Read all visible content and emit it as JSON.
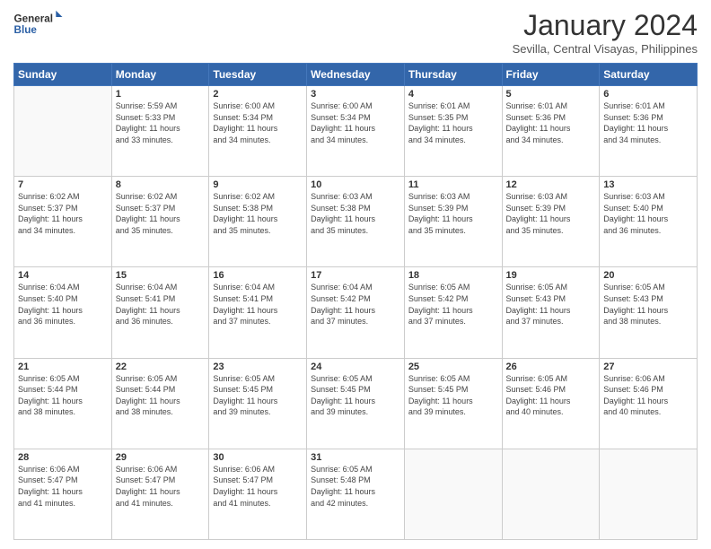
{
  "header": {
    "logo_line1": "General",
    "logo_line2": "Blue",
    "month_title": "January 2024",
    "location": "Sevilla, Central Visayas, Philippines"
  },
  "weekdays": [
    "Sunday",
    "Monday",
    "Tuesday",
    "Wednesday",
    "Thursday",
    "Friday",
    "Saturday"
  ],
  "weeks": [
    [
      {
        "day": "",
        "info": ""
      },
      {
        "day": "1",
        "info": "Sunrise: 5:59 AM\nSunset: 5:33 PM\nDaylight: 11 hours\nand 33 minutes."
      },
      {
        "day": "2",
        "info": "Sunrise: 6:00 AM\nSunset: 5:34 PM\nDaylight: 11 hours\nand 34 minutes."
      },
      {
        "day": "3",
        "info": "Sunrise: 6:00 AM\nSunset: 5:34 PM\nDaylight: 11 hours\nand 34 minutes."
      },
      {
        "day": "4",
        "info": "Sunrise: 6:01 AM\nSunset: 5:35 PM\nDaylight: 11 hours\nand 34 minutes."
      },
      {
        "day": "5",
        "info": "Sunrise: 6:01 AM\nSunset: 5:36 PM\nDaylight: 11 hours\nand 34 minutes."
      },
      {
        "day": "6",
        "info": "Sunrise: 6:01 AM\nSunset: 5:36 PM\nDaylight: 11 hours\nand 34 minutes."
      }
    ],
    [
      {
        "day": "7",
        "info": "Sunrise: 6:02 AM\nSunset: 5:37 PM\nDaylight: 11 hours\nand 34 minutes."
      },
      {
        "day": "8",
        "info": "Sunrise: 6:02 AM\nSunset: 5:37 PM\nDaylight: 11 hours\nand 35 minutes."
      },
      {
        "day": "9",
        "info": "Sunrise: 6:02 AM\nSunset: 5:38 PM\nDaylight: 11 hours\nand 35 minutes."
      },
      {
        "day": "10",
        "info": "Sunrise: 6:03 AM\nSunset: 5:38 PM\nDaylight: 11 hours\nand 35 minutes."
      },
      {
        "day": "11",
        "info": "Sunrise: 6:03 AM\nSunset: 5:39 PM\nDaylight: 11 hours\nand 35 minutes."
      },
      {
        "day": "12",
        "info": "Sunrise: 6:03 AM\nSunset: 5:39 PM\nDaylight: 11 hours\nand 35 minutes."
      },
      {
        "day": "13",
        "info": "Sunrise: 6:03 AM\nSunset: 5:40 PM\nDaylight: 11 hours\nand 36 minutes."
      }
    ],
    [
      {
        "day": "14",
        "info": "Sunrise: 6:04 AM\nSunset: 5:40 PM\nDaylight: 11 hours\nand 36 minutes."
      },
      {
        "day": "15",
        "info": "Sunrise: 6:04 AM\nSunset: 5:41 PM\nDaylight: 11 hours\nand 36 minutes."
      },
      {
        "day": "16",
        "info": "Sunrise: 6:04 AM\nSunset: 5:41 PM\nDaylight: 11 hours\nand 37 minutes."
      },
      {
        "day": "17",
        "info": "Sunrise: 6:04 AM\nSunset: 5:42 PM\nDaylight: 11 hours\nand 37 minutes."
      },
      {
        "day": "18",
        "info": "Sunrise: 6:05 AM\nSunset: 5:42 PM\nDaylight: 11 hours\nand 37 minutes."
      },
      {
        "day": "19",
        "info": "Sunrise: 6:05 AM\nSunset: 5:43 PM\nDaylight: 11 hours\nand 37 minutes."
      },
      {
        "day": "20",
        "info": "Sunrise: 6:05 AM\nSunset: 5:43 PM\nDaylight: 11 hours\nand 38 minutes."
      }
    ],
    [
      {
        "day": "21",
        "info": "Sunrise: 6:05 AM\nSunset: 5:44 PM\nDaylight: 11 hours\nand 38 minutes."
      },
      {
        "day": "22",
        "info": "Sunrise: 6:05 AM\nSunset: 5:44 PM\nDaylight: 11 hours\nand 38 minutes."
      },
      {
        "day": "23",
        "info": "Sunrise: 6:05 AM\nSunset: 5:45 PM\nDaylight: 11 hours\nand 39 minutes."
      },
      {
        "day": "24",
        "info": "Sunrise: 6:05 AM\nSunset: 5:45 PM\nDaylight: 11 hours\nand 39 minutes."
      },
      {
        "day": "25",
        "info": "Sunrise: 6:05 AM\nSunset: 5:45 PM\nDaylight: 11 hours\nand 39 minutes."
      },
      {
        "day": "26",
        "info": "Sunrise: 6:05 AM\nSunset: 5:46 PM\nDaylight: 11 hours\nand 40 minutes."
      },
      {
        "day": "27",
        "info": "Sunrise: 6:06 AM\nSunset: 5:46 PM\nDaylight: 11 hours\nand 40 minutes."
      }
    ],
    [
      {
        "day": "28",
        "info": "Sunrise: 6:06 AM\nSunset: 5:47 PM\nDaylight: 11 hours\nand 41 minutes."
      },
      {
        "day": "29",
        "info": "Sunrise: 6:06 AM\nSunset: 5:47 PM\nDaylight: 11 hours\nand 41 minutes."
      },
      {
        "day": "30",
        "info": "Sunrise: 6:06 AM\nSunset: 5:47 PM\nDaylight: 11 hours\nand 41 minutes."
      },
      {
        "day": "31",
        "info": "Sunrise: 6:05 AM\nSunset: 5:48 PM\nDaylight: 11 hours\nand 42 minutes."
      },
      {
        "day": "",
        "info": ""
      },
      {
        "day": "",
        "info": ""
      },
      {
        "day": "",
        "info": ""
      }
    ]
  ]
}
